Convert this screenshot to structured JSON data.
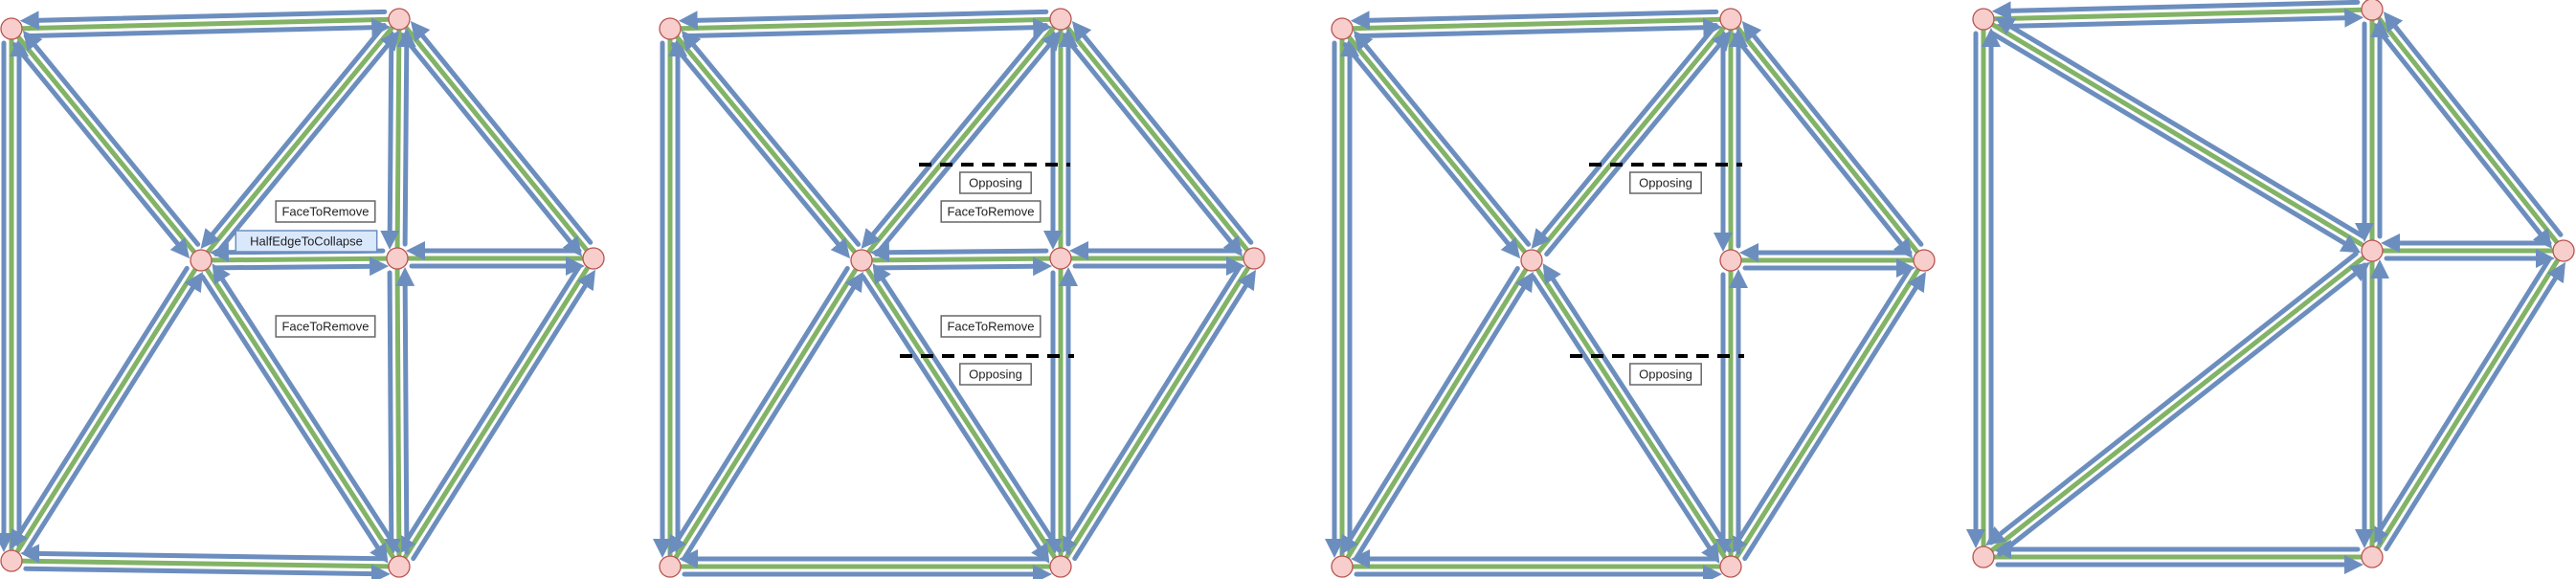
{
  "colors": {
    "edge": "#82b366",
    "half_edge": "#6c8ebf",
    "vertex_fill": "#f8cecc",
    "vertex_stroke": "#b85450",
    "cut_line": "#000000",
    "label_highlight": "#dae8fc"
  },
  "panels": [
    {
      "id": "panel-1",
      "labels": [
        {
          "text": "FaceToRemove",
          "highlight": false
        },
        {
          "text": "HalfEdgeToCollapse",
          "highlight": true
        },
        {
          "text": "FaceToRemove",
          "highlight": false
        }
      ]
    },
    {
      "id": "panel-2",
      "labels": [
        {
          "text": "Opposing",
          "highlight": false
        },
        {
          "text": "FaceToRemove",
          "highlight": false
        },
        {
          "text": "FaceToRemove",
          "highlight": false
        },
        {
          "text": "Opposing",
          "highlight": false
        }
      ]
    },
    {
      "id": "panel-3",
      "labels": [
        {
          "text": "Opposing",
          "highlight": false
        },
        {
          "text": "Opposing",
          "highlight": false
        }
      ]
    },
    {
      "id": "panel-4",
      "labels": []
    }
  ]
}
